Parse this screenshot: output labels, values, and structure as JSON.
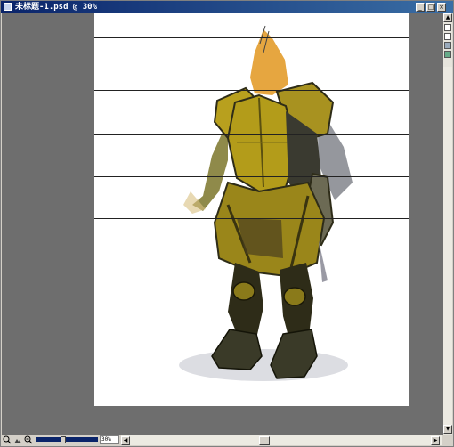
{
  "window": {
    "title": "未标题-1.psd @ 30%",
    "buttons": {
      "minimize": "_",
      "maximize": "□",
      "close": "×"
    }
  },
  "document": {
    "background": "#ffffff",
    "artwork": "armored knight painting"
  },
  "statusbar": {
    "zoom_value": "30%",
    "left_arrow": "◀",
    "right_arrow": "▶"
  },
  "vscroll": {
    "up_arrow": "▲",
    "down_arrow": "▼"
  },
  "colors": {
    "canvas_bg": "#6e6e6e",
    "armor_gold": "#b8a01e",
    "armor_dark": "#2e2c18",
    "hair_orange": "#e6a640"
  }
}
